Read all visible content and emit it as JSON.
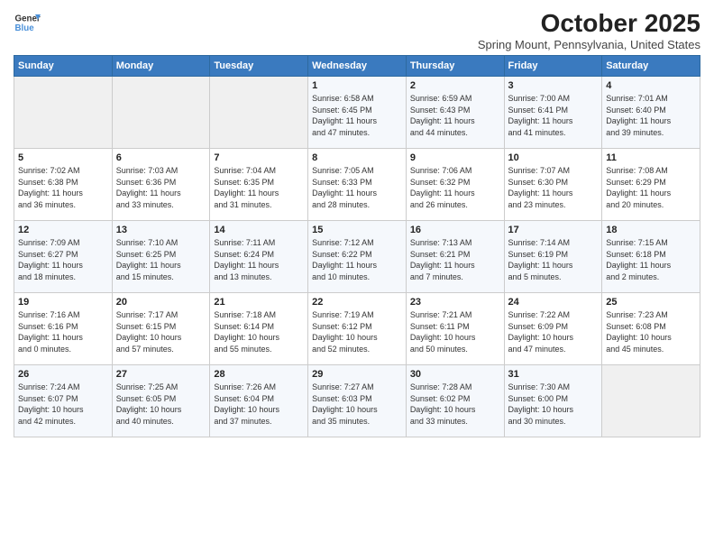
{
  "logo": {
    "line1": "General",
    "line2": "Blue"
  },
  "title": "October 2025",
  "subtitle": "Spring Mount, Pennsylvania, United States",
  "days_header": [
    "Sunday",
    "Monday",
    "Tuesday",
    "Wednesday",
    "Thursday",
    "Friday",
    "Saturday"
  ],
  "weeks": [
    [
      {
        "day": "",
        "info": ""
      },
      {
        "day": "",
        "info": ""
      },
      {
        "day": "",
        "info": ""
      },
      {
        "day": "1",
        "info": "Sunrise: 6:58 AM\nSunset: 6:45 PM\nDaylight: 11 hours\nand 47 minutes."
      },
      {
        "day": "2",
        "info": "Sunrise: 6:59 AM\nSunset: 6:43 PM\nDaylight: 11 hours\nand 44 minutes."
      },
      {
        "day": "3",
        "info": "Sunrise: 7:00 AM\nSunset: 6:41 PM\nDaylight: 11 hours\nand 41 minutes."
      },
      {
        "day": "4",
        "info": "Sunrise: 7:01 AM\nSunset: 6:40 PM\nDaylight: 11 hours\nand 39 minutes."
      }
    ],
    [
      {
        "day": "5",
        "info": "Sunrise: 7:02 AM\nSunset: 6:38 PM\nDaylight: 11 hours\nand 36 minutes."
      },
      {
        "day": "6",
        "info": "Sunrise: 7:03 AM\nSunset: 6:36 PM\nDaylight: 11 hours\nand 33 minutes."
      },
      {
        "day": "7",
        "info": "Sunrise: 7:04 AM\nSunset: 6:35 PM\nDaylight: 11 hours\nand 31 minutes."
      },
      {
        "day": "8",
        "info": "Sunrise: 7:05 AM\nSunset: 6:33 PM\nDaylight: 11 hours\nand 28 minutes."
      },
      {
        "day": "9",
        "info": "Sunrise: 7:06 AM\nSunset: 6:32 PM\nDaylight: 11 hours\nand 26 minutes."
      },
      {
        "day": "10",
        "info": "Sunrise: 7:07 AM\nSunset: 6:30 PM\nDaylight: 11 hours\nand 23 minutes."
      },
      {
        "day": "11",
        "info": "Sunrise: 7:08 AM\nSunset: 6:29 PM\nDaylight: 11 hours\nand 20 minutes."
      }
    ],
    [
      {
        "day": "12",
        "info": "Sunrise: 7:09 AM\nSunset: 6:27 PM\nDaylight: 11 hours\nand 18 minutes."
      },
      {
        "day": "13",
        "info": "Sunrise: 7:10 AM\nSunset: 6:25 PM\nDaylight: 11 hours\nand 15 minutes."
      },
      {
        "day": "14",
        "info": "Sunrise: 7:11 AM\nSunset: 6:24 PM\nDaylight: 11 hours\nand 13 minutes."
      },
      {
        "day": "15",
        "info": "Sunrise: 7:12 AM\nSunset: 6:22 PM\nDaylight: 11 hours\nand 10 minutes."
      },
      {
        "day": "16",
        "info": "Sunrise: 7:13 AM\nSunset: 6:21 PM\nDaylight: 11 hours\nand 7 minutes."
      },
      {
        "day": "17",
        "info": "Sunrise: 7:14 AM\nSunset: 6:19 PM\nDaylight: 11 hours\nand 5 minutes."
      },
      {
        "day": "18",
        "info": "Sunrise: 7:15 AM\nSunset: 6:18 PM\nDaylight: 11 hours\nand 2 minutes."
      }
    ],
    [
      {
        "day": "19",
        "info": "Sunrise: 7:16 AM\nSunset: 6:16 PM\nDaylight: 11 hours\nand 0 minutes."
      },
      {
        "day": "20",
        "info": "Sunrise: 7:17 AM\nSunset: 6:15 PM\nDaylight: 10 hours\nand 57 minutes."
      },
      {
        "day": "21",
        "info": "Sunrise: 7:18 AM\nSunset: 6:14 PM\nDaylight: 10 hours\nand 55 minutes."
      },
      {
        "day": "22",
        "info": "Sunrise: 7:19 AM\nSunset: 6:12 PM\nDaylight: 10 hours\nand 52 minutes."
      },
      {
        "day": "23",
        "info": "Sunrise: 7:21 AM\nSunset: 6:11 PM\nDaylight: 10 hours\nand 50 minutes."
      },
      {
        "day": "24",
        "info": "Sunrise: 7:22 AM\nSunset: 6:09 PM\nDaylight: 10 hours\nand 47 minutes."
      },
      {
        "day": "25",
        "info": "Sunrise: 7:23 AM\nSunset: 6:08 PM\nDaylight: 10 hours\nand 45 minutes."
      }
    ],
    [
      {
        "day": "26",
        "info": "Sunrise: 7:24 AM\nSunset: 6:07 PM\nDaylight: 10 hours\nand 42 minutes."
      },
      {
        "day": "27",
        "info": "Sunrise: 7:25 AM\nSunset: 6:05 PM\nDaylight: 10 hours\nand 40 minutes."
      },
      {
        "day": "28",
        "info": "Sunrise: 7:26 AM\nSunset: 6:04 PM\nDaylight: 10 hours\nand 37 minutes."
      },
      {
        "day": "29",
        "info": "Sunrise: 7:27 AM\nSunset: 6:03 PM\nDaylight: 10 hours\nand 35 minutes."
      },
      {
        "day": "30",
        "info": "Sunrise: 7:28 AM\nSunset: 6:02 PM\nDaylight: 10 hours\nand 33 minutes."
      },
      {
        "day": "31",
        "info": "Sunrise: 7:30 AM\nSunset: 6:00 PM\nDaylight: 10 hours\nand 30 minutes."
      },
      {
        "day": "",
        "info": ""
      }
    ]
  ]
}
